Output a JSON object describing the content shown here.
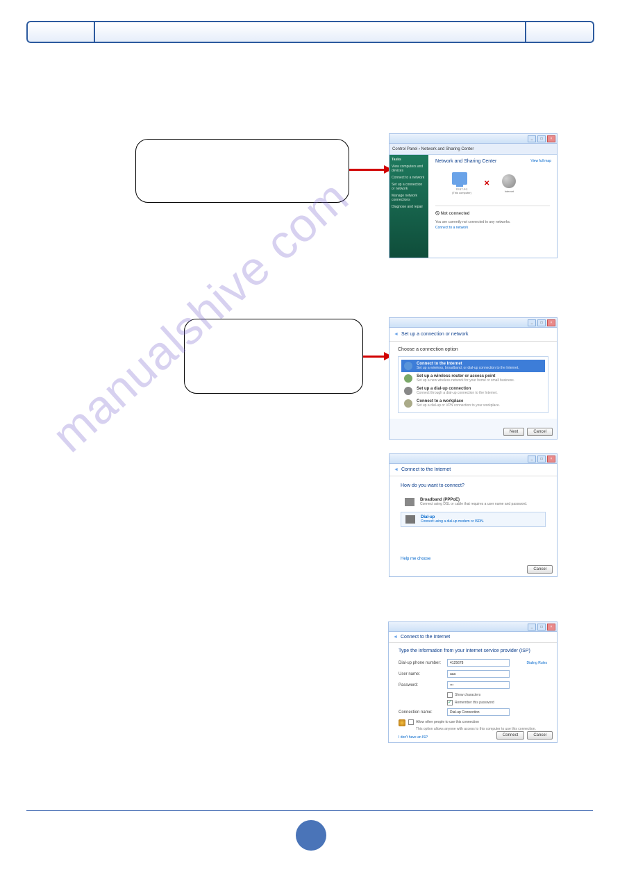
{
  "header": {
    "left": "",
    "middle": "",
    "right": ""
  },
  "watermark": "manualshive com",
  "ss1": {
    "breadcrumb": "Control Panel › Network and Sharing Center",
    "sidebar": {
      "tasks": "Tasks",
      "i1": "View computers and devices",
      "i2": "Connect to a network",
      "i3": "Set up a connection or network",
      "i4": "Manage network connections",
      "i5": "Diagnose and repair"
    },
    "title": "Network and Sharing Center",
    "viewmap": "View full map",
    "pc_label": "TEST-PC\n(This computer)",
    "inet_label": "Internet",
    "notconn_title": "Not connected",
    "notconn_desc": "You are currently not connected to any networks.",
    "notconn_link": "Connect to a network"
  },
  "ss2": {
    "head_icon": "◄",
    "head": "Set up a connection or network",
    "subtitle": "Choose a connection option",
    "opt1t": "Connect to the Internet",
    "opt1d": "Set up a wireless, broadband, or dial-up connection to the Internet.",
    "opt2t": "Set up a wireless router or access point",
    "opt2d": "Set up a new wireless network for your home or small business.",
    "opt3t": "Set up a dial-up connection",
    "opt3d": "Connect through a dial-up connection to the Internet.",
    "opt4t": "Connect to a workplace",
    "opt4d": "Set up a dial-up or VPN connection to your workplace.",
    "next": "Next",
    "cancel": "Cancel"
  },
  "ss3": {
    "head_icon": "◄",
    "head": "Connect to the Internet",
    "q": "How do you want to connect?",
    "bt": "Broadband (PPPoE)",
    "bd": "Connect using DSL or cable that requires a user name and password.",
    "dt": "Dial-up",
    "dd": "Connect using a dial-up modem or ISDN.",
    "help": "Help me choose",
    "cancel": "Cancel"
  },
  "ss4": {
    "head_icon": "◄",
    "head": "Connect to the Internet",
    "title": "Type the information from your Internet service provider (ISP)",
    "l_phone": "Dial-up phone number:",
    "v_phone": "4125678",
    "dialrules": "Dialing Rules",
    "l_user": "User name:",
    "v_user": "aaa",
    "l_pass": "Password:",
    "v_pass": "•••",
    "showchars": "Show characters",
    "remember": "Remember this password",
    "l_conn": "Connection name:",
    "v_conn": "Dial-up Connection",
    "allow": "Allow other people to use this connection",
    "allow_desc": "This option allows anyone with access to this computer to use this connection.",
    "noisp": "I don't have an ISP",
    "connect": "Connect",
    "cancel": "Cancel"
  }
}
